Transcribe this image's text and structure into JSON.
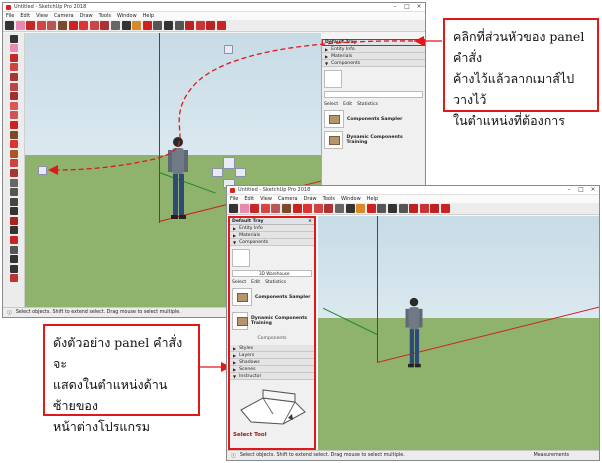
{
  "window_top": {
    "title": "Untitled - SketchUp Pro 2018",
    "menus": [
      "File",
      "Edit",
      "View",
      "Camera",
      "Draw",
      "Tools",
      "Window",
      "Help"
    ],
    "status": "Select objects. Shift to extend select. Drag mouse to select multiple.",
    "tray": {
      "title": "Default Tray",
      "panels": [
        "Entity Info",
        "Materials",
        "Components"
      ],
      "tabs": [
        "Select",
        "Edit",
        "Statistics"
      ],
      "items": [
        "Components Sampler",
        "Dynamic Components Training"
      ]
    }
  },
  "window_bottom": {
    "title": "Untitled - SketchUp Pro 2018",
    "menus": [
      "File",
      "Edit",
      "View",
      "Camera",
      "Draw",
      "Tools",
      "Window",
      "Help"
    ],
    "status": "Select objects. Shift to extend select. Drag mouse to select multiple.",
    "measurements_label": "Measurements",
    "tray": {
      "title": "Default Tray",
      "panels": [
        "Entity Info",
        "Materials",
        "Components"
      ],
      "tabs": [
        "Select",
        "Edit",
        "Statistics"
      ],
      "search_value": "3D Warehouse",
      "items": [
        "Components Sampler",
        "Dynamic Components Training"
      ],
      "section_label": "Components",
      "lower_panels": [
        "Styles",
        "Layers",
        "Shadows",
        "Scenes",
        "Instructor"
      ],
      "instructor_caption": "Select Tool"
    }
  },
  "callouts": {
    "top": [
      "คลิกที่ส่วนหัวของ panel คำสั่ง",
      "ค้างไว้แล้วลากเมาส์ไปวางไว้",
      "ในตำแหน่งที่ต้องการ"
    ],
    "bottom": [
      "ดังตัวอย่าง panel คำสั่งจะ",
      "แสดงในตำแหน่งด้านซ้ายของ",
      "หน้าต่างโปรแกรม"
    ]
  },
  "colors": {
    "sky": "#cfe0ea",
    "ground": "#8fb26d",
    "highlight": "#e01818",
    "blue_axis": "#2a3fd0",
    "green_axis": "#1f8a2a"
  }
}
